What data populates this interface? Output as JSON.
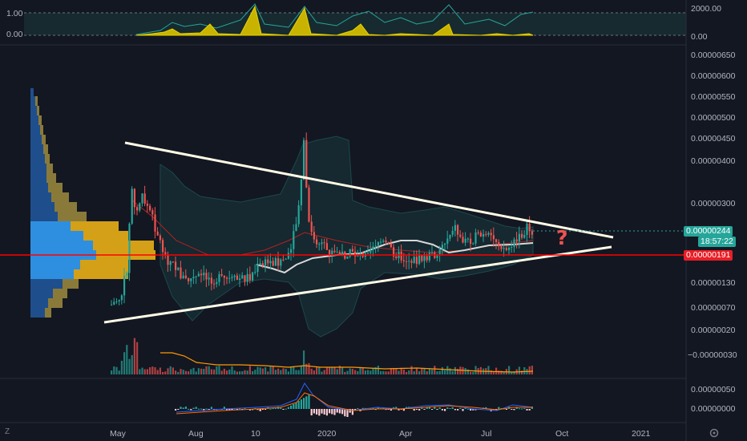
{
  "chart": {
    "price_axis_labels": [
      "0.00000650",
      "0.00000600",
      "0.00000550",
      "0.00000500",
      "0.00000450",
      "0.00000400",
      "0.00000300",
      "0.00000130",
      "0.00000070",
      "0.00000020",
      "−0.00000030"
    ],
    "time_axis_labels": [
      "May",
      "Aug",
      "10",
      "2020",
      "Apr",
      "Jul",
      "Oct",
      "2021"
    ],
    "price_tag": "0.00000244",
    "countdown_tag": "18:57:22",
    "level_tag": "0.00000191",
    "annotation": "?",
    "log_toggle": "Z"
  },
  "top_indicator": {
    "left_labels": [
      "1.00",
      "0.00"
    ],
    "right_labels": [
      "2000.00",
      "0.00"
    ]
  },
  "macd_pane": {
    "right_labels": [
      "0.00000050",
      "0.00000000"
    ]
  },
  "colors": {
    "background": "#131722",
    "up": "#26a69a",
    "down": "#ef5350",
    "triangle": "#fffbe6",
    "level_line": "#ff0000",
    "vp_up": "#2962ff",
    "vp_down": "#d4a017",
    "vol_ma": "#ff9800"
  }
}
